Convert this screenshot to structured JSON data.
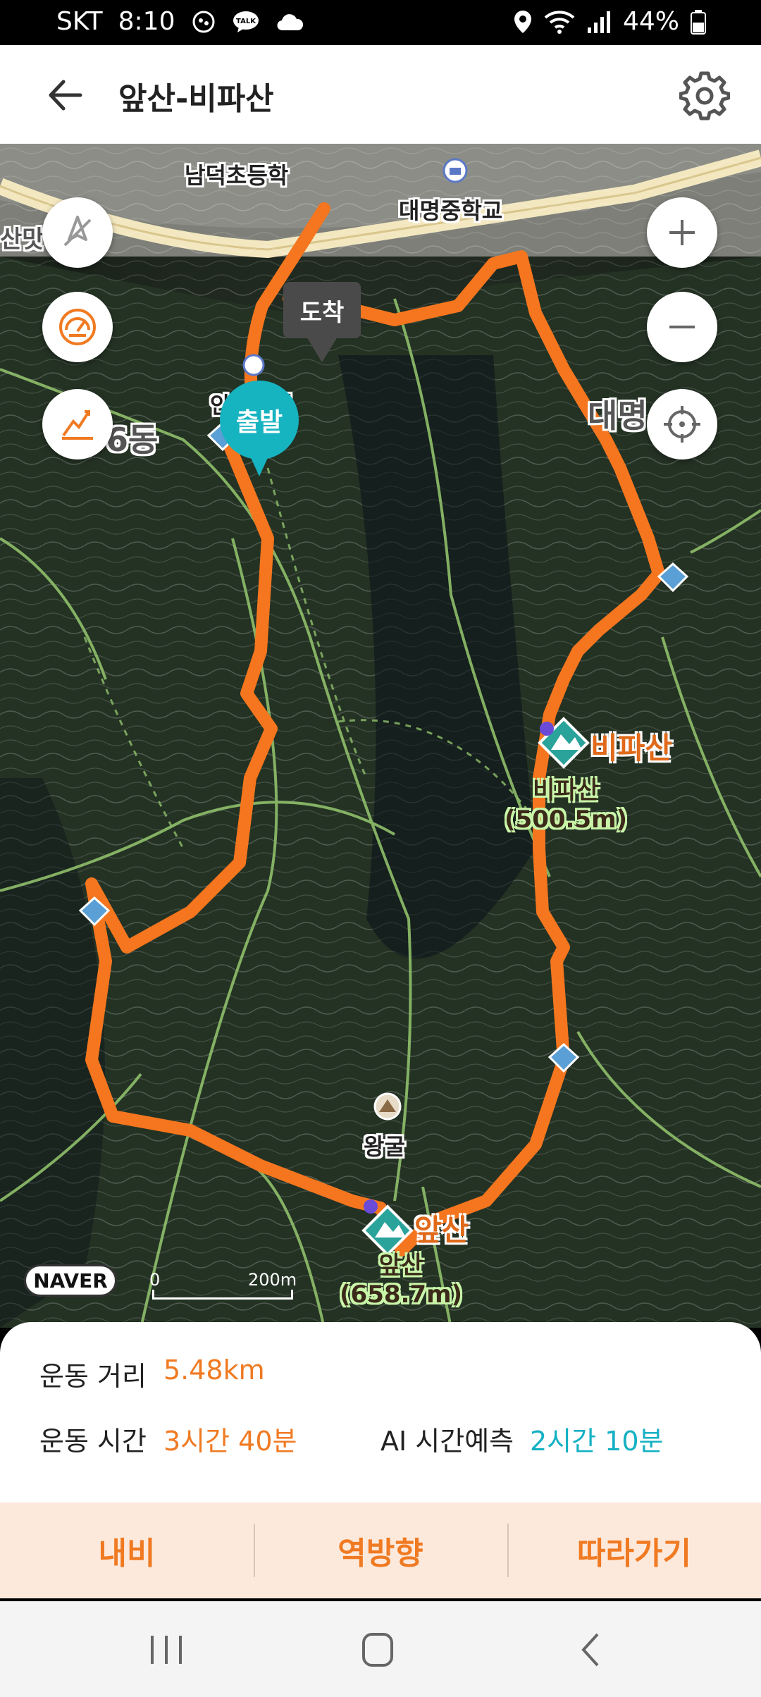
{
  "status_bar": {
    "carrier": "SKT",
    "time": "8:10",
    "battery": "44%",
    "icons": [
      "footprint-icon",
      "talk-icon",
      "cloud-icon",
      "location-icon",
      "wifi-icon",
      "signal-icon",
      "battery-icon"
    ]
  },
  "header": {
    "title": "앞산-비파산"
  },
  "map": {
    "labels": {
      "school1": "남덕초등학",
      "school2": "대명중학교",
      "place1": "안지랭이",
      "district1": "6동",
      "district2": "대명",
      "district3": "산맛",
      "cave": "왕굴"
    },
    "peaks": [
      {
        "name": "비파산",
        "label_name": "비파산",
        "elevation": "(500.5m)"
      },
      {
        "name": "앞산",
        "label_name": "앞산",
        "elevation": "(658.7m)"
      }
    ],
    "start_pin": "출발",
    "end_pin": "도착",
    "naver": "NAVER",
    "scale_start": "0",
    "scale_end": "200m",
    "route_color": "#f5761e",
    "start_color": "#16b3c0"
  },
  "stats": {
    "distance_label": "운동 거리",
    "distance_value": "5.48km",
    "time_label": "운동 시간",
    "time_value": "3시간 40분",
    "ai_label": "AI 시간예측",
    "ai_value": "2시간 10분"
  },
  "actions": {
    "navi": "내비",
    "reverse": "역방향",
    "follow": "따라가기"
  }
}
